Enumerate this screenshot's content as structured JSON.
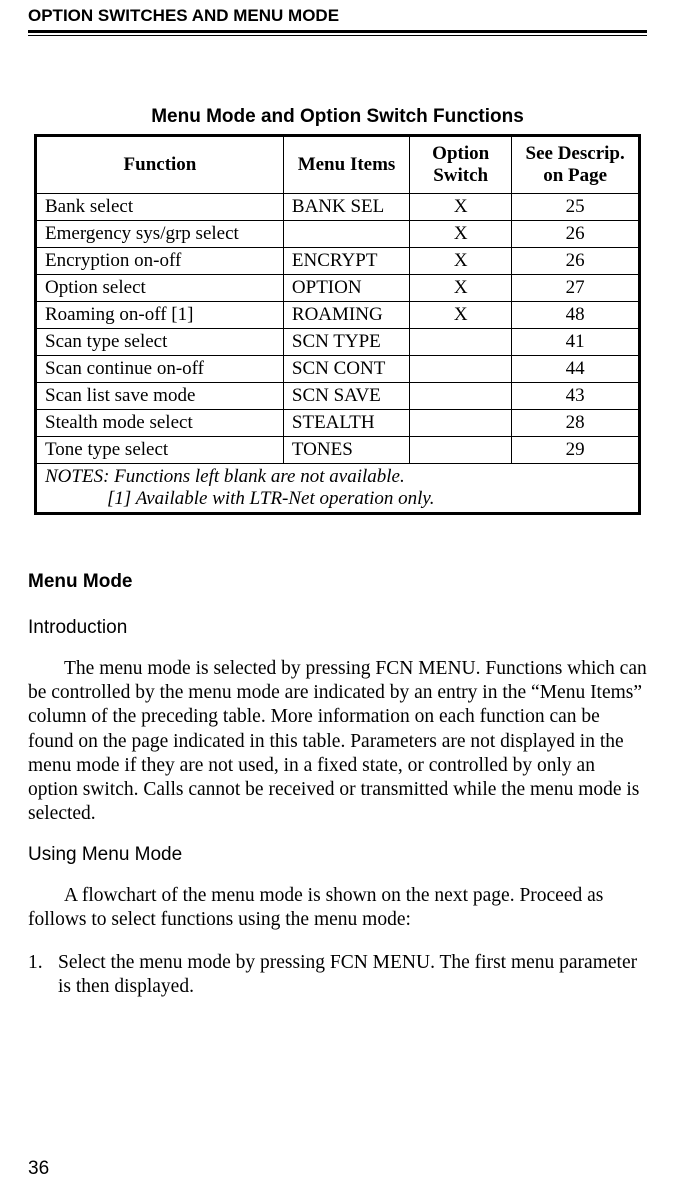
{
  "running_head": "OPTION SWITCHES AND MENU MODE",
  "table_title": "Menu Mode and Option Switch Functions",
  "table": {
    "headers": {
      "function": "Function",
      "menu_items": "Menu Items",
      "option_switch": "Option Switch",
      "see_page": "See Descrip. on Page"
    },
    "rows": [
      {
        "function": "Bank select",
        "menu": "BANK SEL",
        "switch": "X",
        "page": "25"
      },
      {
        "function": "Emergency sys/grp select",
        "menu": "",
        "switch": "X",
        "page": "26"
      },
      {
        "function": "Encryption on-off",
        "menu": "ENCRYPT",
        "switch": "X",
        "page": "26"
      },
      {
        "function": "Option select",
        "menu": "OPTION",
        "switch": "X",
        "page": "27"
      },
      {
        "function": "Roaming on-off [1]",
        "menu": "ROAMING",
        "switch": "X",
        "page": "48"
      },
      {
        "function": "Scan type select",
        "menu": "SCN TYPE",
        "switch": "",
        "page": "41"
      },
      {
        "function": "Scan continue on-off",
        "menu": "SCN CONT",
        "switch": "",
        "page": "44"
      },
      {
        "function": "Scan list save mode",
        "menu": "SCN SAVE",
        "switch": "",
        "page": "43"
      },
      {
        "function": "Stealth mode select",
        "menu": "STEALTH",
        "switch": "",
        "page": "28"
      },
      {
        "function": "Tone type select",
        "menu": "TONES",
        "switch": "",
        "page": "29"
      }
    ],
    "notes_line1": "NOTES: Functions left blank are not available.",
    "notes_line2": "[1] Available with LTR-Net operation only."
  },
  "section_heading": "Menu Mode",
  "subheading_intro": "Introduction",
  "para_intro": "The menu mode is selected by pressing FCN MENU. Functions which can be controlled by the menu mode are indicated by an entry in the “Menu Items” column of the preceding table. More information on each function can be found on the page indicated in this table. Parameters are not displayed in the menu mode if they are not used, in a fixed state, or controlled by only an option switch. Calls cannot be received or transmitted while the menu mode is selected.",
  "subheading_using": "Using Menu Mode",
  "para_using": "A flowchart of the menu mode is shown on the next page. Proceed as follows to select functions using the menu mode:",
  "list": {
    "item1_num": "1.",
    "item1_text": "Select the menu mode by pressing FCN MENU. The first menu parameter is then displayed."
  },
  "page_number": "36",
  "chart_data": {
    "type": "table",
    "title": "Menu Mode and Option Switch Functions",
    "columns": [
      "Function",
      "Menu Items",
      "Option Switch",
      "See Descrip. on Page"
    ],
    "rows": [
      [
        "Bank select",
        "BANK SEL",
        "X",
        25
      ],
      [
        "Emergency sys/grp select",
        "",
        "X",
        26
      ],
      [
        "Encryption on-off",
        "ENCRYPT",
        "X",
        26
      ],
      [
        "Option select",
        "OPTION",
        "X",
        27
      ],
      [
        "Roaming on-off [1]",
        "ROAMING",
        "X",
        48
      ],
      [
        "Scan type select",
        "SCN TYPE",
        "",
        41
      ],
      [
        "Scan continue on-off",
        "SCN CONT",
        "",
        44
      ],
      [
        "Scan list save mode",
        "SCN SAVE",
        "",
        43
      ],
      [
        "Stealth mode select",
        "STEALTH",
        "",
        28
      ],
      [
        "Tone type select",
        "TONES",
        "",
        29
      ]
    ],
    "notes": [
      "Functions left blank are not available.",
      "[1] Available with LTR-Net operation only."
    ]
  }
}
